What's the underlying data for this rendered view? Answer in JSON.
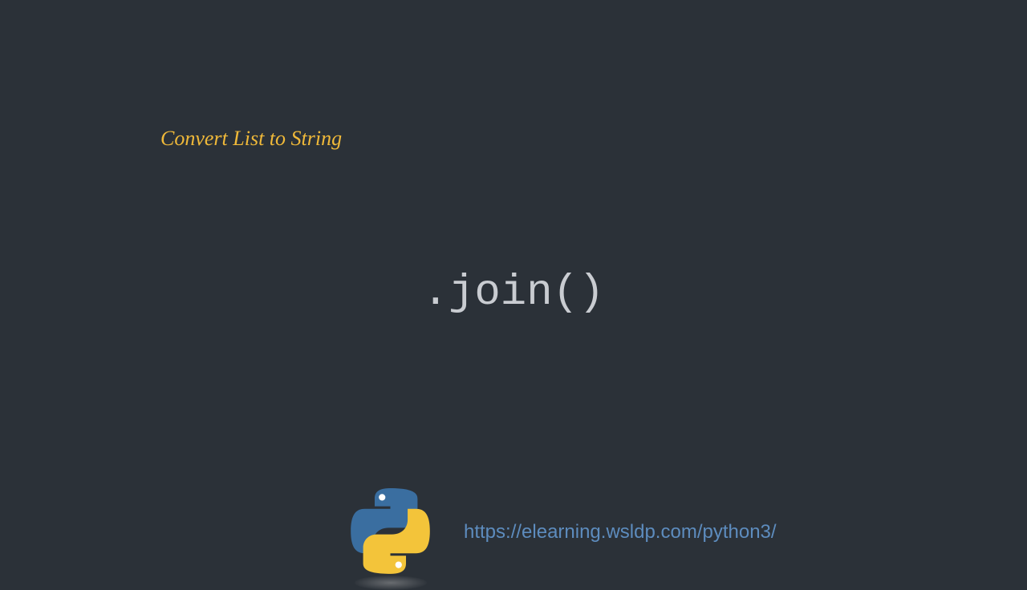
{
  "heading": "Convert List to String",
  "code": ".join()",
  "url": "https://elearning.wsldp.com/python3/",
  "logo": {
    "blue": "#3a6ea0",
    "yellow": "#f3c43a"
  }
}
